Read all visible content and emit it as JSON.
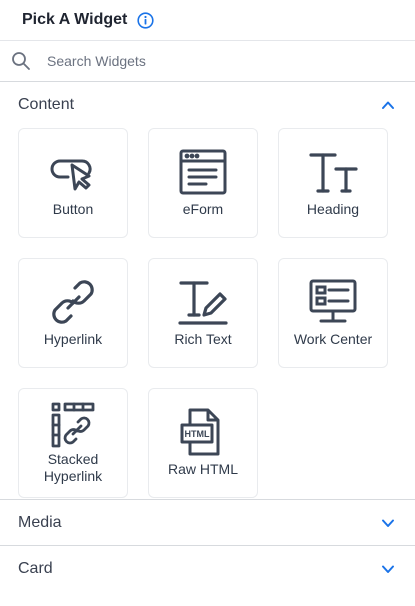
{
  "header": {
    "title": "Pick A Widget",
    "info_icon": "info-circle-icon"
  },
  "search": {
    "placeholder": "Search Widgets",
    "value": "",
    "icon": "search-icon"
  },
  "colors": {
    "accent": "#1a73e8",
    "icon_stroke": "#3c4656",
    "text": "#2f3a4a"
  },
  "sections": [
    {
      "title": "Content",
      "expanded": true,
      "widgets": [
        {
          "label": "Button",
          "icon": "button-cursor-icon"
        },
        {
          "label": "eForm",
          "icon": "eform-window-icon"
        },
        {
          "label": "Heading",
          "icon": "heading-tt-icon"
        },
        {
          "label": "Hyperlink",
          "icon": "chain-link-icon"
        },
        {
          "label": "Rich Text",
          "icon": "rich-text-pencil-icon"
        },
        {
          "label": "Work Center",
          "icon": "work-center-monitor-icon"
        },
        {
          "label": "Stacked Hyperlink",
          "label_lines": [
            "Stacked",
            "Hyperlink"
          ],
          "icon": "stacked-hyperlink-icon"
        },
        {
          "label": "Raw HTML",
          "icon": "html-file-icon",
          "icon_text": "HTML"
        }
      ]
    },
    {
      "title": "Media",
      "expanded": false
    },
    {
      "title": "Card",
      "expanded": false
    }
  ]
}
